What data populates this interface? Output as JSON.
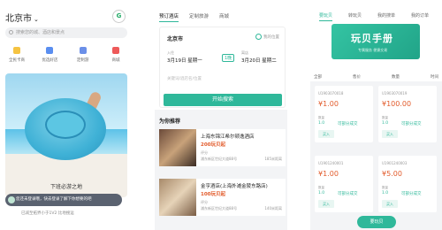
{
  "screen1": {
    "city": "北京市",
    "logo_text": "G",
    "search_placeholder": "搜索您的城、酒店和景点",
    "categories": [
      "全民卡商",
      "优选好店",
      "定制游",
      "商城"
    ],
    "banner_caption": "下班必游之地",
    "toast_text": "您还未登录哦，快去登录了解下你想要的吧",
    "footer_text": "已减至拓界小于1V2    比地搜运"
  },
  "screen2": {
    "tabs": [
      "预订酒店",
      "定制旅游",
      "商城"
    ],
    "city": "北京市",
    "location_label": "我的位置",
    "checkin_label": "入住",
    "checkin_date": "3月19日 星期一",
    "checkout_label": "离店",
    "checkout_date": "3月20日 星期二",
    "nights": "1晚",
    "keyword_placeholder": "关键词/酒店名/位置",
    "search_button": "开始搜索",
    "recommend_title": "为你推荐",
    "hotels": [
      {
        "name": "上海东锦江希尔顿逸酒店",
        "price": "200玩贝起",
        "tag": "评分",
        "address": "浦东新区世纪大道88号",
        "distance": "185米距离"
      },
      {
        "name": "金亨酒店(上海外滩金陵东路店)",
        "price": "100玩贝起",
        "tag": "评分",
        "address": "浦东新区世纪大道88号",
        "distance": "140米距离"
      }
    ]
  },
  "screen3": {
    "tabs": [
      "要玩贝",
      "转玩贝",
      "我的搜单",
      "我的订单"
    ],
    "hero_title": "玩贝手册",
    "hero_sub": "专属服务 便捷交易",
    "filters": [
      "全部",
      "售价",
      "数量",
      "时间"
    ],
    "tickets": [
      {
        "id": "U1903070018",
        "price": "¥1.00",
        "qty_label": "数量",
        "qty": "1.0",
        "nego": "可部分成交",
        "buy": "买入"
      },
      {
        "id": "U1903070019",
        "price": "¥100.00",
        "qty_label": "数量",
        "qty": "1.0",
        "nego": "可部分成交",
        "buy": "买入"
      },
      {
        "id": "U1901240001",
        "price": "¥1.00",
        "qty_label": "数量",
        "qty": "1.0",
        "nego": "可部分成交",
        "buy": "买入"
      },
      {
        "id": "U1901240003",
        "price": "¥5.00",
        "qty_label": "数量",
        "qty": "1.0",
        "nego": "可部分成交",
        "buy": "买入"
      }
    ],
    "fab_label": "要玩贝"
  }
}
